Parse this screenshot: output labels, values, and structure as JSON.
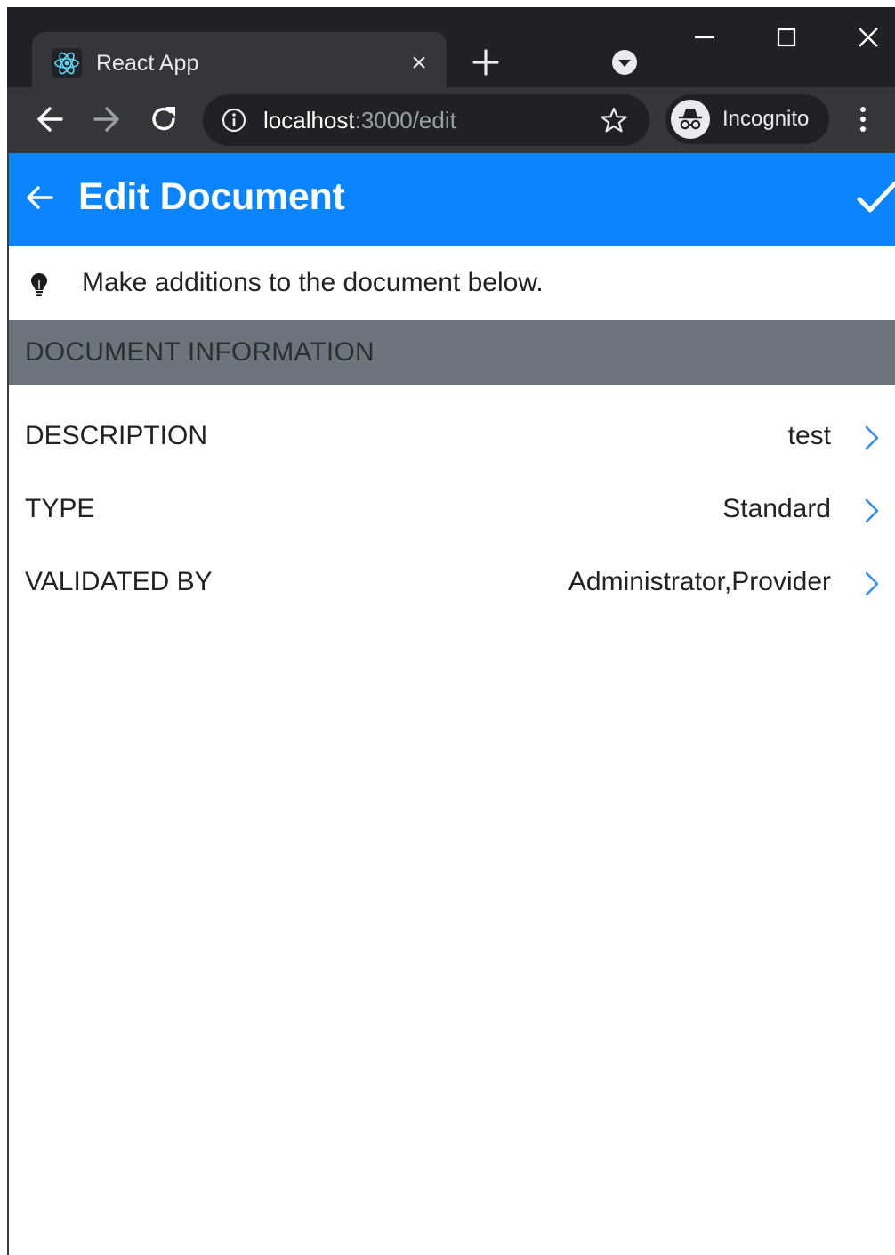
{
  "browser": {
    "tab_title": "React App",
    "tab_close": "×",
    "url_host": "localhost",
    "url_path": ":3000/edit",
    "incognito_label": "Incognito"
  },
  "icons": {
    "favicon": "react-logo-icon",
    "new_tab": "plus-icon",
    "tab_search": "chevron-down-circle-icon",
    "back": "arrow-left-icon",
    "forward": "arrow-right-icon",
    "reload": "reload-icon",
    "site_info": "info-icon",
    "bookmark": "star-icon",
    "incognito": "incognito-icon",
    "menu": "kebab-menu-icon",
    "hint": "lightbulb-icon",
    "row_action": "chevron-right-icon",
    "save": "check-icon"
  },
  "colors": {
    "appbar": "#0a84ff",
    "section_header": "#6c757d",
    "chevron": "#3b8eea",
    "chrome_dark": "#202124",
    "chrome_toolbar": "#35363a"
  },
  "header": {
    "title": "Edit Document"
  },
  "hint": {
    "text": "Make additions to the document below."
  },
  "section": {
    "title": "DOCUMENT INFORMATION"
  },
  "fields": [
    {
      "label": "DESCRIPTION",
      "value": "test"
    },
    {
      "label": "TYPE",
      "value": "Standard"
    },
    {
      "label": "VALIDATED BY",
      "value": "Administrator,Provider"
    }
  ]
}
